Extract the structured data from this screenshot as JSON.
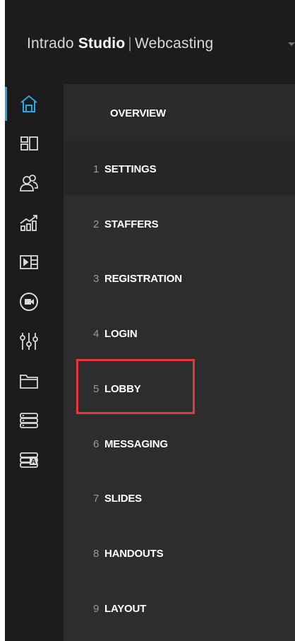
{
  "header": {
    "brand_prefix": "Intrado",
    "brand_product": "Studio",
    "brand_separator": "|",
    "brand_suffix": "Webcasting"
  },
  "rail": {
    "accent_color": "#29a8e0",
    "icon_color": "#d9d9d9",
    "items": [
      {
        "icon": "home-icon",
        "active": true
      },
      {
        "icon": "layout-grid-icon"
      },
      {
        "icon": "users-icon"
      },
      {
        "icon": "analytics-chart-icon"
      },
      {
        "icon": "media-player-icon"
      },
      {
        "icon": "video-camera-icon"
      },
      {
        "icon": "sliders-icon"
      },
      {
        "icon": "folder-icon"
      },
      {
        "icon": "database-icon"
      },
      {
        "icon": "server-a-icon"
      }
    ]
  },
  "nav": {
    "overview_label": "OVERVIEW",
    "items": [
      {
        "num": "1",
        "label": "SETTINGS"
      },
      {
        "num": "2",
        "label": "STAFFERS"
      },
      {
        "num": "3",
        "label": "REGISTRATION"
      },
      {
        "num": "4",
        "label": "LOGIN"
      },
      {
        "num": "5",
        "label": "LOBBY"
      },
      {
        "num": "6",
        "label": "MESSAGING"
      },
      {
        "num": "7",
        "label": "SLIDES"
      },
      {
        "num": "8",
        "label": "HANDOUTS"
      },
      {
        "num": "9",
        "label": "LAYOUT"
      }
    ]
  },
  "highlight_color": "#e5383b"
}
